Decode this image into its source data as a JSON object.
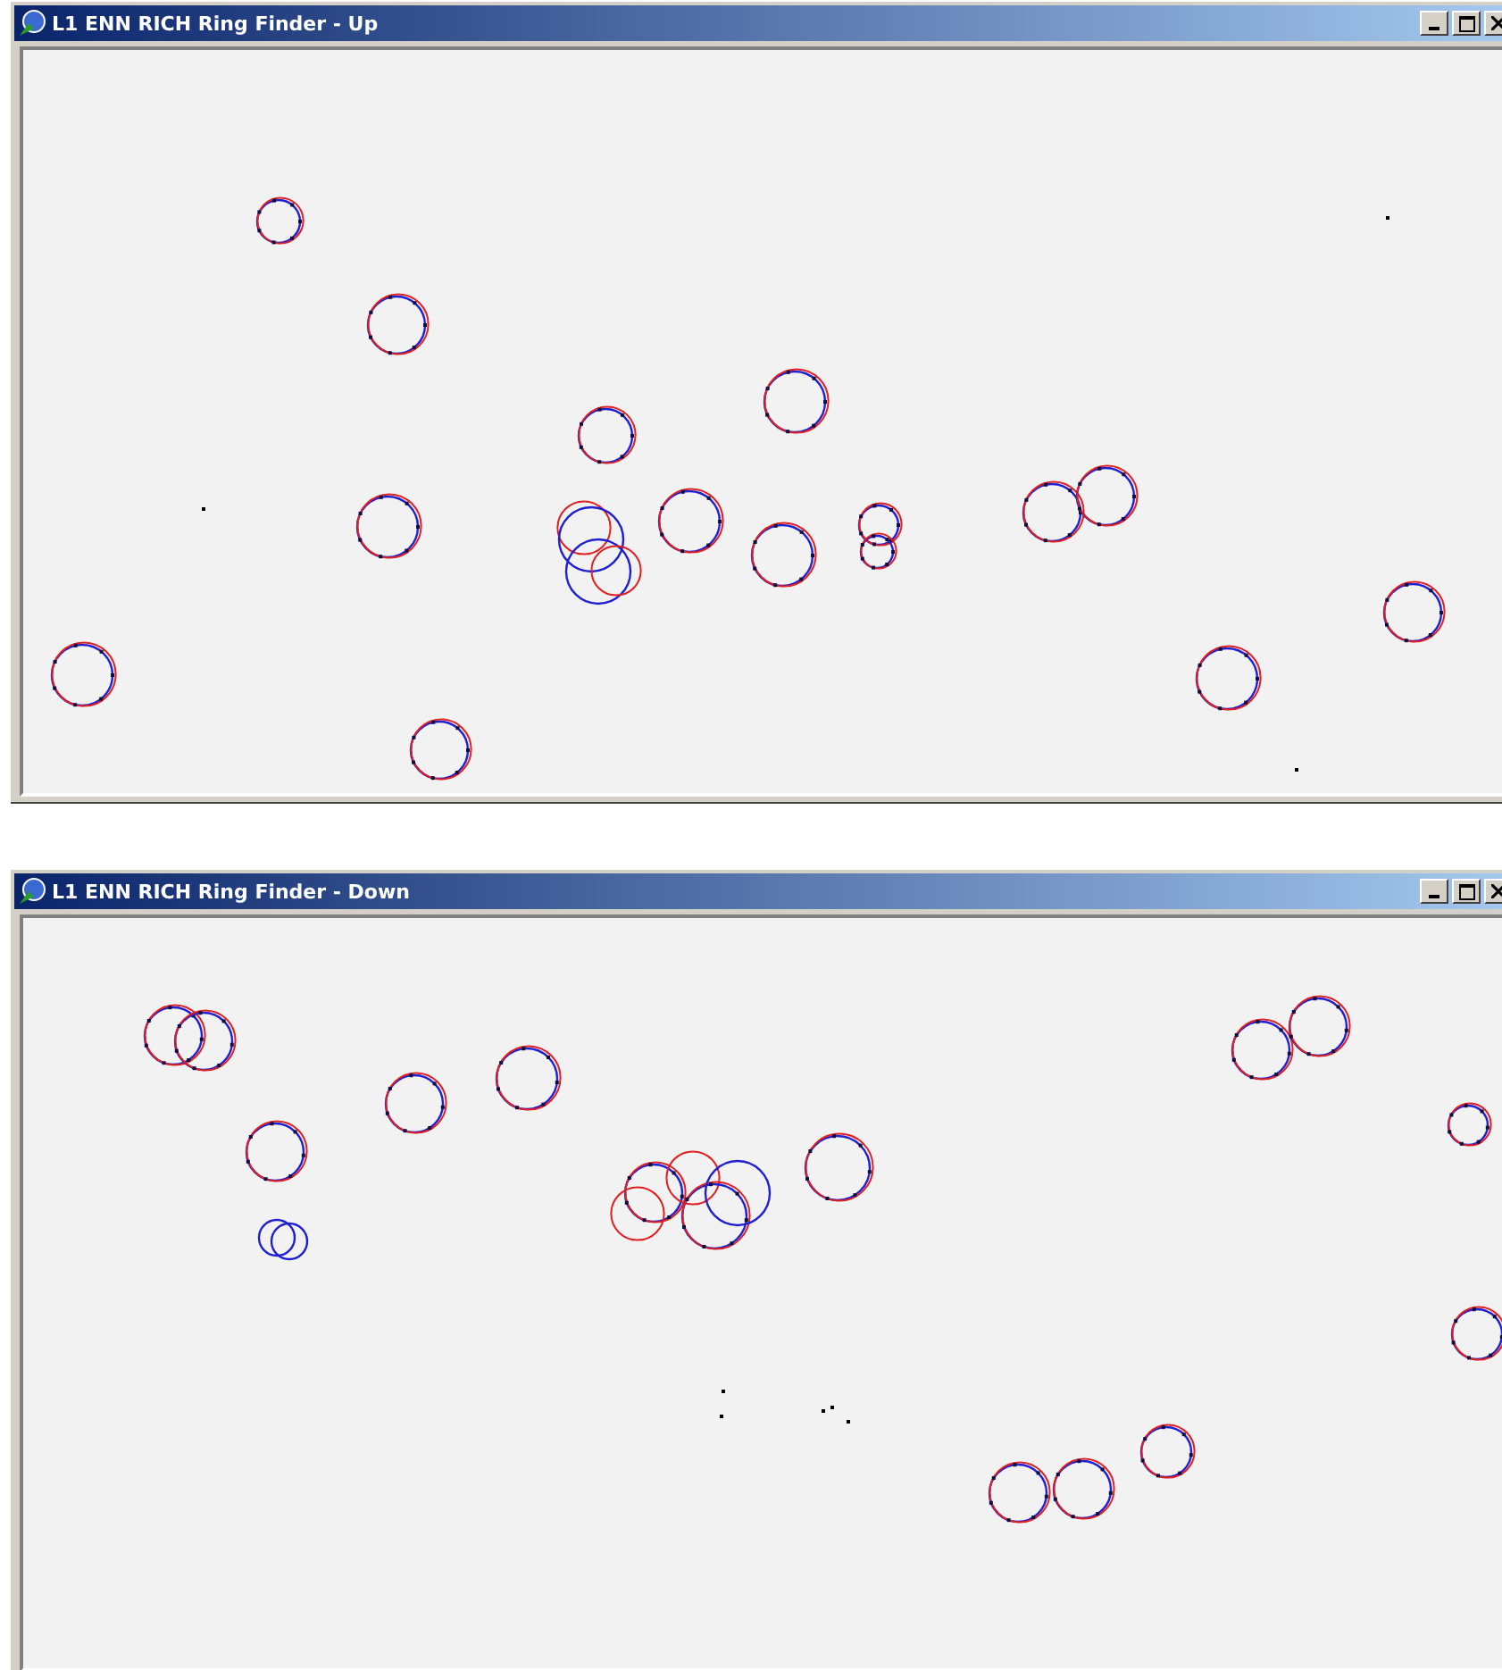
{
  "windows": [
    {
      "title": "L1 ENN RICH Ring Finder - Up"
    },
    {
      "title": "L1 ENN RICH Ring Finder - Down"
    }
  ]
}
